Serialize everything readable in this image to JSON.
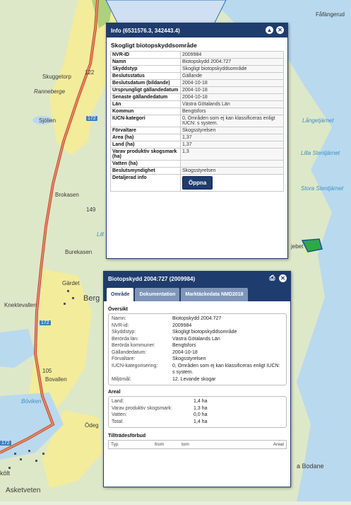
{
  "map": {
    "labels": {
      "fafangerud": "Fåfängerud",
      "skuggetorp": "Skuggetorp",
      "rannebergen": "Ranneberge",
      "sjolien": "Sjölien",
      "brokasen": "Brokasen",
      "burekasen": "Burekasen",
      "gardet": "Gärdet",
      "knektevallen": "Knektevallen",
      "berg": "Berg",
      "bovallen": "Bovallen",
      "boviken": "Böviken",
      "asketveten": "Asketveten",
      "kolt": "költ",
      "bodane": "a Bodane",
      "langetjarnet": "Långetjärnet",
      "lilla_stentjarnet": "Lilla Stentjärnet",
      "stora_stentjarnet": "Stora Stentjärnet",
      "lill": "Lill",
      "jebet": "jebet",
      "odeg": "Ödeg",
      "n122": "122",
      "n149": "149",
      "n105": "105",
      "road172a": "172",
      "road172b": "172",
      "road172c": "172"
    }
  },
  "info": {
    "header_title": "Info (6531576.3, 342443.4)",
    "title": "Skogligt biotopskyddsområde",
    "rows": [
      {
        "key": "NVR-ID",
        "value": "2009984"
      },
      {
        "key": "Namn",
        "value": "Biotopskydd 2004:727"
      },
      {
        "key": "Skyddstyp",
        "value": "Skogligt biotopskyddsområde"
      },
      {
        "key": "Beslutsstatus",
        "value": "Gällande"
      },
      {
        "key": "Beslutsdatum (bildande)",
        "value": "2004-10-18"
      },
      {
        "key": "Ursprungligt gällandedatum",
        "value": "2004-10-18"
      },
      {
        "key": "Senaste gällandedatum",
        "value": "2004-10-18"
      },
      {
        "key": "Län",
        "value": "Västra Götalands Län"
      },
      {
        "key": "Kommun",
        "value": "Bengtsfors"
      },
      {
        "key": "IUCN-kategori",
        "value": "0, Områden som ej kan klassificeras enligt IUCN: s system."
      },
      {
        "key": "Förvaltare",
        "value": "Skogsstyrelsen"
      },
      {
        "key": "Area (ha)",
        "value": "1,37"
      },
      {
        "key": "Land (ha)",
        "value": "1,37"
      },
      {
        "key": "Varav produktiv skogsmark (ha)",
        "value": "1,3"
      },
      {
        "key": "Vatten (ha)",
        "value": ""
      },
      {
        "key": "Beslutsmyndighet",
        "value": "Skogsstyrelsen"
      }
    ],
    "detail_key": "Detaljerad info",
    "open_label": "Öppna"
  },
  "bio": {
    "header_title": "Biotopskydd 2004:727 (2009984)",
    "tabs": [
      "Område",
      "Dokumentation",
      "Marktäckedata NMD2018"
    ],
    "overview_title": "Översikt",
    "overview": [
      {
        "label": "Namn:",
        "value": "Biotopskydd 2004:727"
      },
      {
        "label": "NVR-id:",
        "value": "2009984"
      },
      {
        "label": "Skyddstyp:",
        "value": "Skogligt biotopskyddsområde"
      },
      {
        "label": "Berörda län:",
        "value": "Västra Götalands Län"
      },
      {
        "label": "Berörda kommuner:",
        "value": "Bengtsfors"
      },
      {
        "label": "Gällandedatum:",
        "value": "2004-10-18"
      },
      {
        "label": "Förvaltare:",
        "value": "Skogsstyrelsen"
      },
      {
        "label": "IUCN-kategorisering:",
        "value": "0, Områden som ej kan klassificeras enligt IUCN: s system."
      },
      {
        "label": "Miljömål:",
        "value": "12. Levande skogar"
      }
    ],
    "area_title": "Areal",
    "area": [
      {
        "label": "Land:",
        "value": "1,4 ha"
      },
      {
        "label": "Varav produktiv skogsmark:",
        "value": "1,3 ha"
      },
      {
        "label": "Vatten:",
        "value": "0,0 ha"
      },
      {
        "label": "Total:",
        "value": "1,4 ha"
      }
    ],
    "access_title": "Tillträdesförbud",
    "access_cols": [
      "Typ",
      "from",
      "tom",
      "Areal"
    ]
  },
  "colors": {
    "header": "#1f3c6e",
    "water": "#b9d9ee",
    "forest": "#dceac8",
    "open_land": "#f5ef9e",
    "road": "#c0502f",
    "protected_area": "#2fa84a"
  }
}
